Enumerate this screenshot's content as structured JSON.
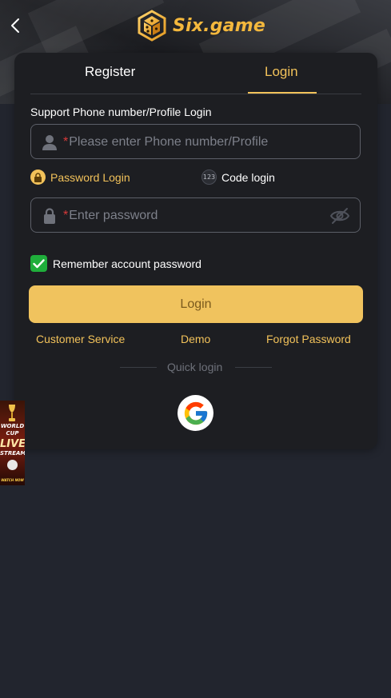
{
  "header": {
    "brand_name": "Six.game",
    "brand_color": "#f4b83d"
  },
  "tabs": [
    {
      "label": "Register",
      "active": false
    },
    {
      "label": "Login",
      "active": true
    }
  ],
  "form": {
    "support_label": "Support Phone number/Profile Login",
    "phone": {
      "required_mark": "*",
      "placeholder": "Please enter Phone number/Profile",
      "icon": "user-icon"
    },
    "modes": [
      {
        "label": "Password Login",
        "icon": "lock-icon",
        "active": true
      },
      {
        "label": "Code login",
        "icon": "code-123-icon",
        "icon_text": "123",
        "active": false
      }
    ],
    "password": {
      "required_mark": "*",
      "placeholder": "Enter password",
      "icon": "lock-icon",
      "toggle_icon": "eye-hidden-icon"
    },
    "remember": {
      "label": "Remember account password",
      "checked": true,
      "check_color": "#1fae3b"
    },
    "submit_label": "Login",
    "submit_color": "#f0c35e"
  },
  "links": {
    "customer_service": "Customer Service",
    "demo": "Demo",
    "forgot_password": "Forgot Password"
  },
  "quick_login": {
    "label": "Quick login",
    "providers": [
      {
        "name": "google",
        "icon": "google-icon"
      }
    ]
  },
  "promo_banner": {
    "line1": "WORLD",
    "line2": "CUP",
    "line3": "LIVE",
    "line4": "STREAM",
    "cta": "WATCH NOW"
  },
  "colors": {
    "page_background": "#22252e",
    "card_background": "#1d1e22",
    "accent": "#f2c25a",
    "required": "#d93a3a"
  }
}
